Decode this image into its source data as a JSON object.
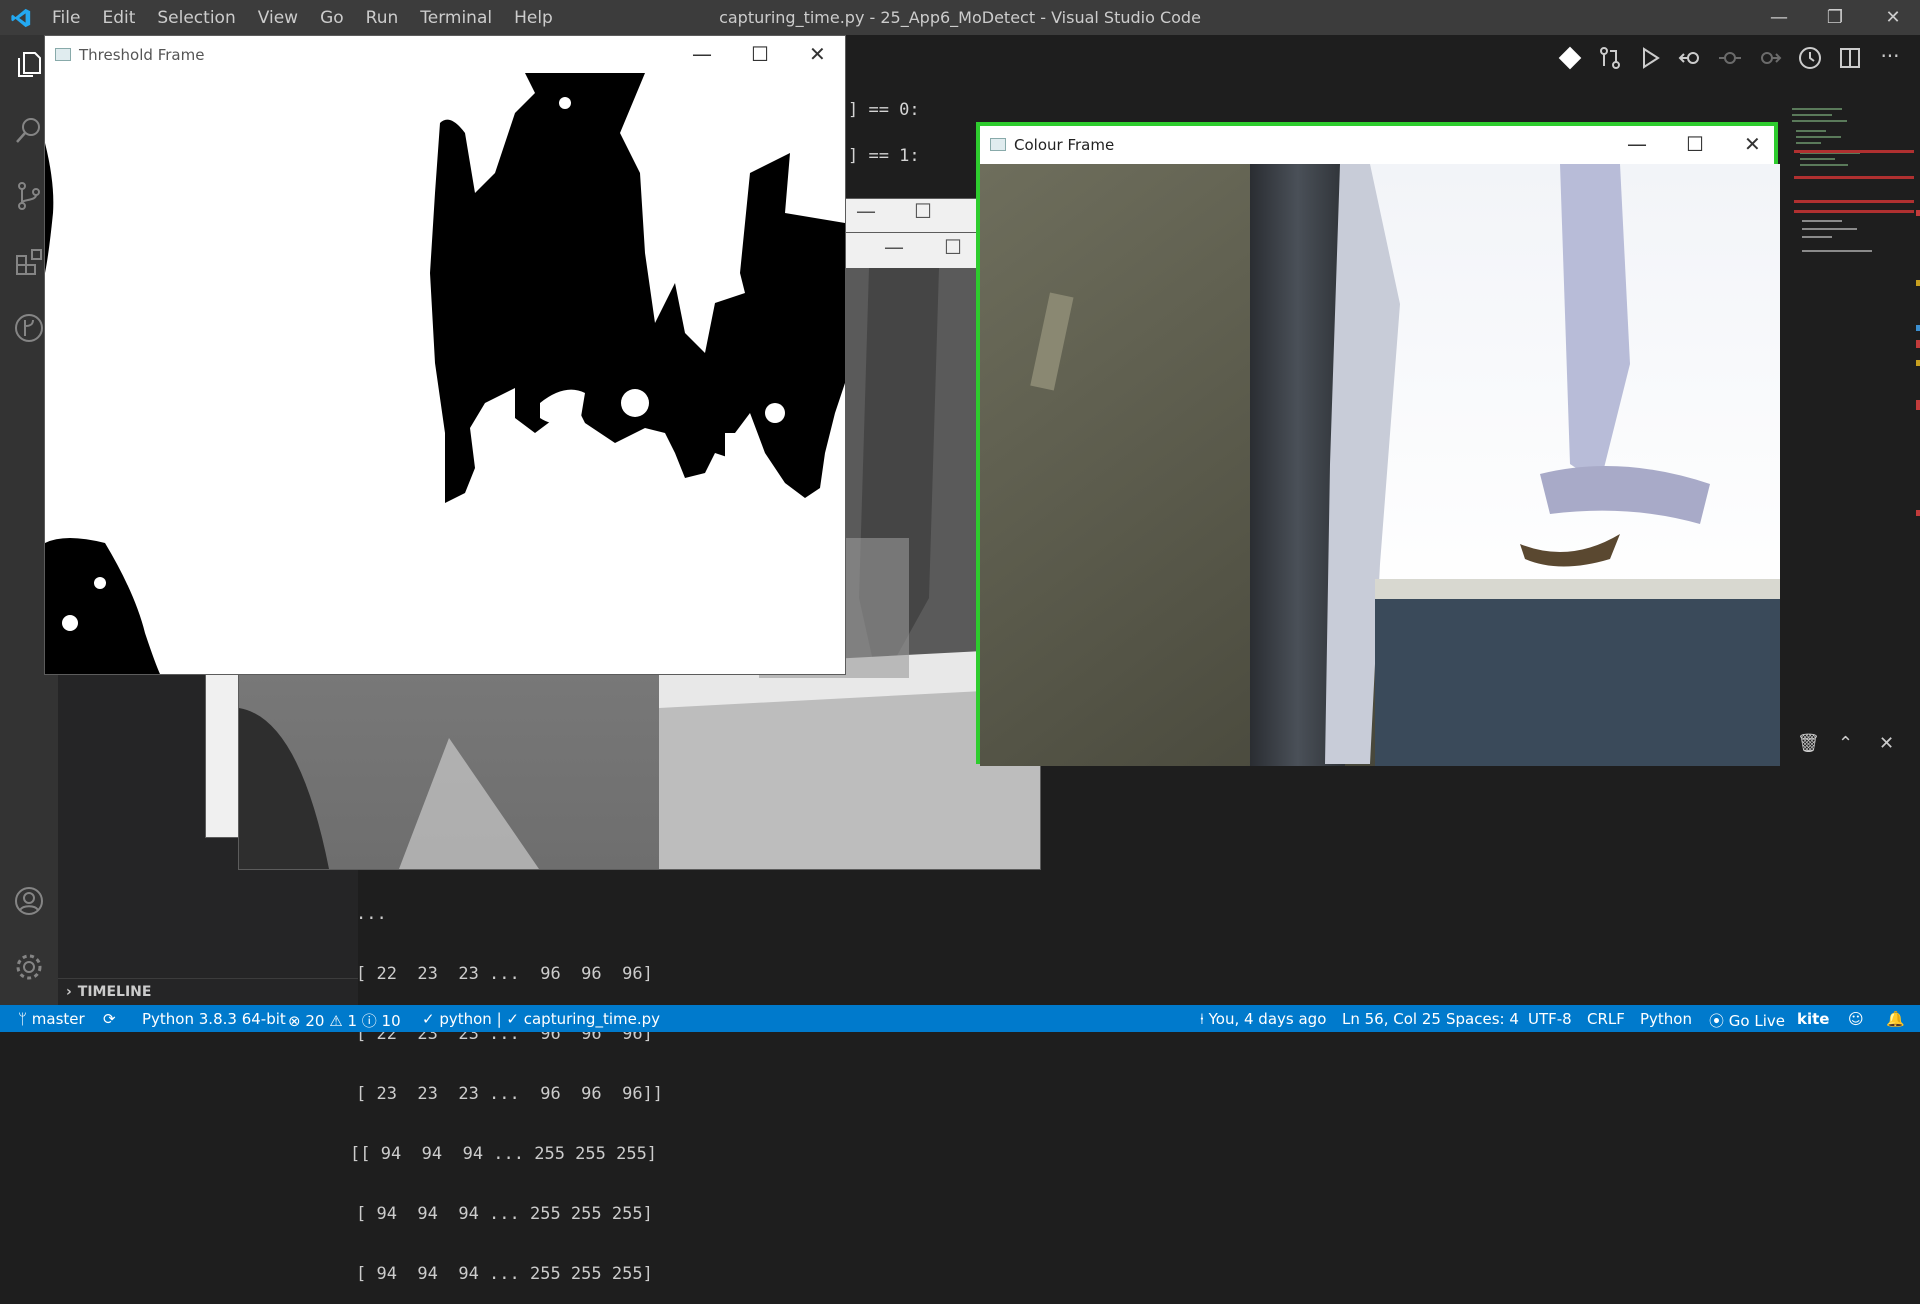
{
  "titlebar": {
    "title": "capturing_time.py - 25_App6_MoDetect - Visual Studio Code",
    "menu": [
      "File",
      "Edit",
      "Selection",
      "View",
      "Go",
      "Run",
      "Terminal",
      "Help"
    ]
  },
  "editor": {
    "code_lines": [
      "] == 0:",
      "] == 1:"
    ]
  },
  "sidebar": {
    "timeline_label": "TIMELINE"
  },
  "terminal": {
    "lines": [
      "...",
      "[ 22  23  23 ...  96  96  96]",
      "[ 22  23  23 ...  96  96  96]",
      "[ 23  23  23 ...  96  96  96]]",
      "[[ 94  94  94 ... 255 255 255]",
      "[ 94  94  94 ... 255 255 255]",
      "[ 94  94  94 ... 255 255 255]"
    ]
  },
  "windows": {
    "threshold": {
      "title": "Threshold Frame"
    },
    "colour": {
      "title": "Colour Frame",
      "border_color": "#2ecc2e"
    }
  },
  "statusbar": {
    "branch": "master",
    "interpreter": "Python 3.8.3 64-bit",
    "errors": "20",
    "warnings": "1",
    "infos": "10",
    "task": "python | ✓ capturing_time.py",
    "blame": "You, 4 days ago",
    "position": "Ln 56, Col 25",
    "spaces": "Spaces: 4",
    "encoding": "UTF-8",
    "eol": "CRLF",
    "language": "Python",
    "golive": "Go Live",
    "kite": "kite"
  },
  "colors": {
    "accent": "#007acc",
    "titlebar": "#3c3c3c",
    "activity": "#333333"
  }
}
